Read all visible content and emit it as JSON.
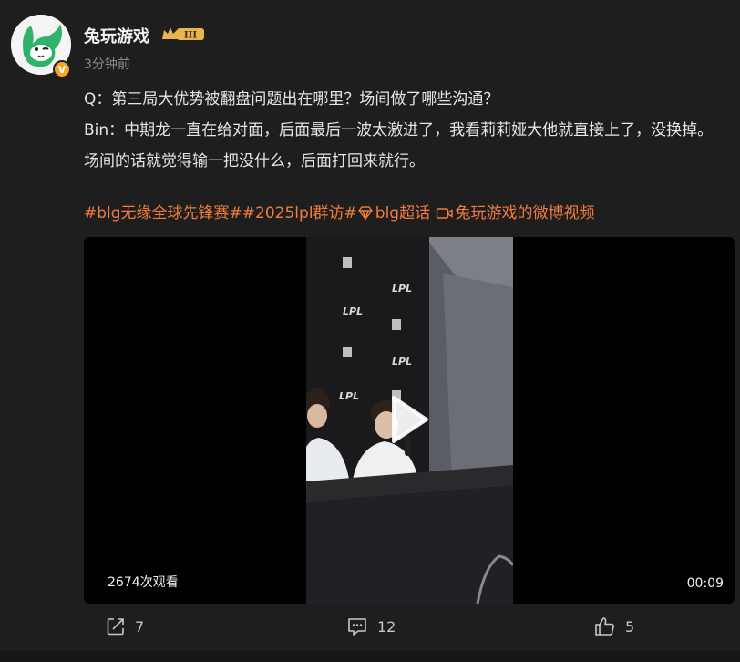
{
  "header": {
    "username": "兔玩游戏",
    "level_badge": "III",
    "timestamp": "3分钟前",
    "verified_icon": "verified-v-icon"
  },
  "post": {
    "line1": "Q：第三局大优势被翻盘问题出在哪里？场间做了哪些沟通？",
    "line2": "Bin：中期龙一直在给对面，后面最后一波太激进了，我看莉莉娅大他就直接上了，没换掉。场间的话就觉得输一把没什么，后面打回来就行。"
  },
  "tags": {
    "tag1": "#blg无缘全球先锋赛#",
    "tag2": "#2025lpl群访#",
    "tag3": "blg超话",
    "tag4": "兔玩游戏的微博视频"
  },
  "video": {
    "views": "2674次观看",
    "duration": "00:09",
    "backdrop_logos": [
      "LPL",
      "LPL",
      "LPL",
      "LPL"
    ]
  },
  "actions": {
    "share_count": "7",
    "comment_count": "12",
    "like_count": "5"
  },
  "colors": {
    "background": "#1e1e1e",
    "tag": "#f07b3b",
    "text": "#e6e6e6",
    "muted": "#8a8a8a"
  }
}
